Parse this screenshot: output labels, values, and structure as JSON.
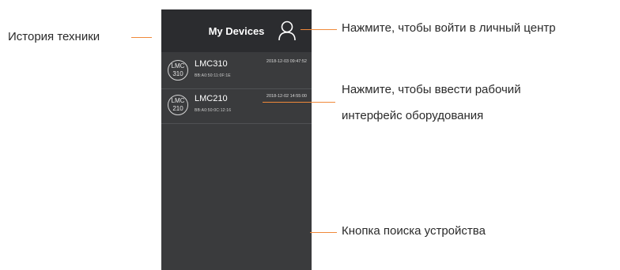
{
  "app": {
    "title": "My Devices",
    "devices": [
      {
        "badge_top": "LMC",
        "badge_bottom": "310",
        "name": "LMC310",
        "mac": "BB:A0:50:11:0F:1E",
        "time": "2018-12-03 09:47:52"
      },
      {
        "badge_top": "LMC",
        "badge_bottom": "210",
        "name": "LMC210",
        "mac": "BB:A0:50:0C:12:16",
        "time": "2018-12-02 14:55:00"
      }
    ]
  },
  "callouts": {
    "history": "История техники",
    "login": "Нажмите, чтобы войти в личный центр",
    "interface_line1": "Нажмите, чтобы ввести рабочий",
    "interface_line2": "интерфейс оборудования",
    "search": "Кнопка поиска устройства"
  },
  "colors": {
    "accent": "#f0893a",
    "phone_bg": "#3a3b3d",
    "header_bg": "#2b2c2f"
  },
  "icons": {
    "user": "user-icon",
    "search": "search-icon",
    "device_badge": "device-badge"
  }
}
